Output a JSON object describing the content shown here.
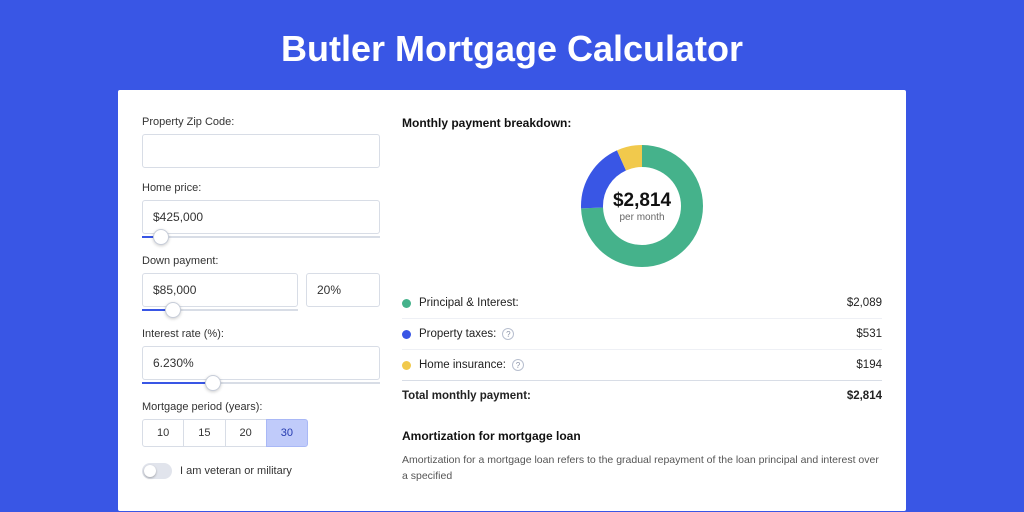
{
  "title": "Butler Mortgage Calculator",
  "form": {
    "zip_label": "Property Zip Code:",
    "zip_value": "",
    "home_price_label": "Home price:",
    "home_price_value": "$425,000",
    "home_price_slider_pct": 8,
    "down_payment_label": "Down payment:",
    "down_payment_value": "$85,000",
    "down_payment_pct_value": "20%",
    "down_payment_slider_pct": 20,
    "interest_label": "Interest rate (%):",
    "interest_value": "6.230%",
    "interest_slider_pct": 30,
    "period_label": "Mortgage period (years):",
    "period_options": [
      "10",
      "15",
      "20",
      "30"
    ],
    "period_selected": "30",
    "veteran_label": "I am veteran or military",
    "veteran_on": false
  },
  "breakdown": {
    "title": "Monthly payment breakdown:",
    "center_value": "$2,814",
    "center_sub": "per month",
    "items": [
      {
        "label": "Principal & Interest:",
        "amount": "$2,089",
        "color": "green",
        "help": false
      },
      {
        "label": "Property taxes:",
        "amount": "$531",
        "color": "blue",
        "help": true
      },
      {
        "label": "Home insurance:",
        "amount": "$194",
        "color": "yellow",
        "help": true
      }
    ],
    "total_label": "Total monthly payment:",
    "total_amount": "$2,814"
  },
  "colors": {
    "green": "#45b28b",
    "blue": "#3956e5",
    "yellow": "#f1c94c"
  },
  "chart_data": {
    "type": "pie",
    "title": "Monthly payment breakdown",
    "series": [
      {
        "name": "Principal & Interest",
        "value": 2089,
        "color": "#45b28b"
      },
      {
        "name": "Property taxes",
        "value": 531,
        "color": "#3956e5"
      },
      {
        "name": "Home insurance",
        "value": 194,
        "color": "#f1c94c"
      }
    ],
    "total": 2814,
    "unit": "USD per month"
  },
  "amortization": {
    "title": "Amortization for mortgage loan",
    "text": "Amortization for a mortgage loan refers to the gradual repayment of the loan principal and interest over a specified"
  }
}
